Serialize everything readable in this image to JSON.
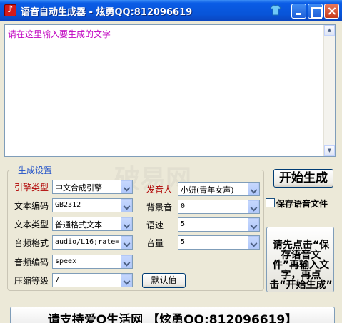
{
  "window": {
    "title": "语音自动生成器 - 炫勇QQ:812096619"
  },
  "text_area": {
    "placeholder": "请在这里输入要生成的文字"
  },
  "settings": {
    "group_title": "生成设置",
    "engine_type": {
      "label": "引擎类型",
      "value": "中文合成引擎"
    },
    "text_encoding": {
      "label": "文本编码",
      "value": "GB2312"
    },
    "text_type": {
      "label": "文本类型",
      "value": "普通格式文本"
    },
    "audio_format": {
      "label": "音频格式",
      "value": "audio/L16;rate="
    },
    "audio_encoding": {
      "label": "音频编码",
      "value": "speex"
    },
    "compression_level": {
      "label": "压缩等级",
      "value": "7"
    },
    "speaker": {
      "label": "发音人",
      "value": "小妍(青年女声)"
    },
    "background_sound": {
      "label": "背景音",
      "value": "0"
    },
    "speed": {
      "label": "语速",
      "value": "5"
    },
    "volume": {
      "label": "音量",
      "value": "5"
    },
    "default_button": "默认值"
  },
  "actions": {
    "start_button": "开始生成",
    "save_checkbox_label": "保存语音文件",
    "save_checked": false,
    "hint": "请先点击“保存语音文件”再输入文字，再点击“开始生成”"
  },
  "footer": {
    "text": "请支持爱Q生活网 【炫勇QQ:812096619】"
  },
  "watermark": "破易网"
}
